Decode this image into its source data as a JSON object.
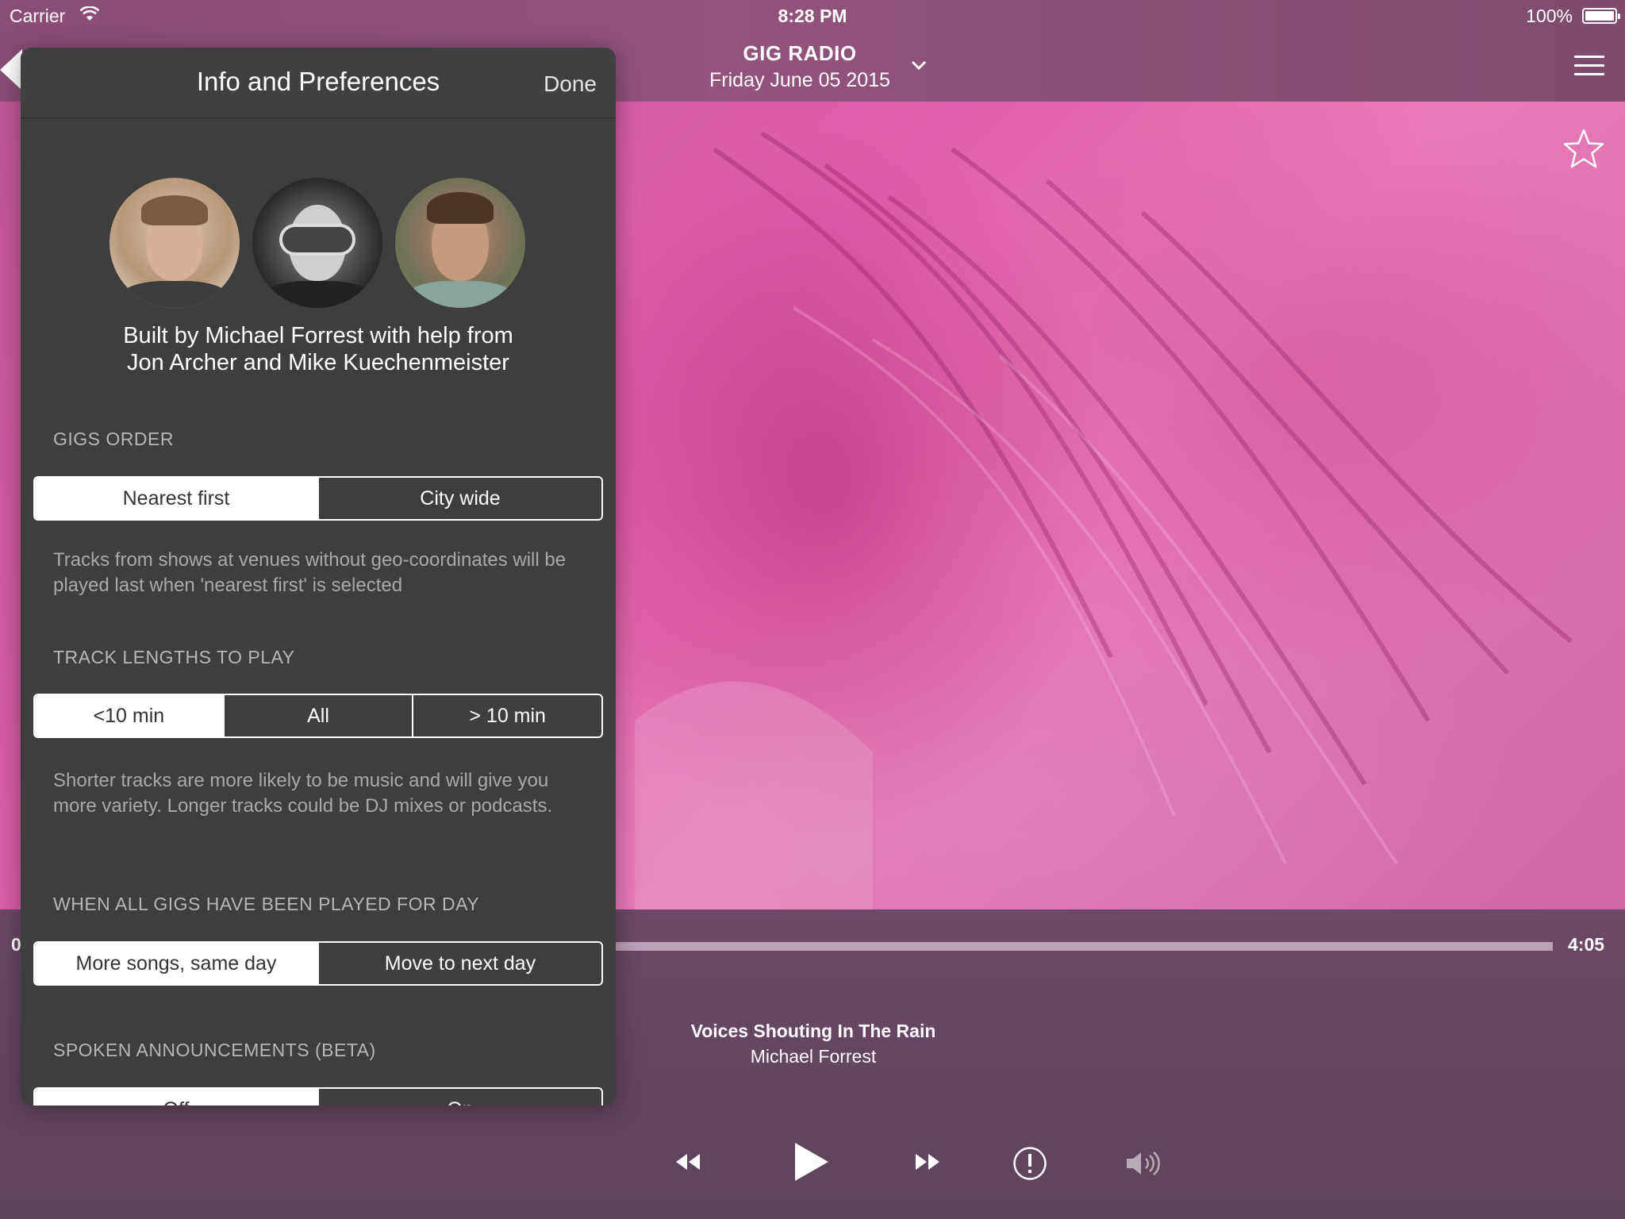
{
  "status_bar": {
    "carrier": "Carrier",
    "time": "8:28 PM",
    "battery": "100%"
  },
  "nav": {
    "station_name": "GIG RADIO",
    "station_date": "Friday June 05 2015",
    "icons": [
      "back-arrow-icon",
      "chevron-down-icon",
      "hamburger-menu-icon",
      "star-icon"
    ]
  },
  "player": {
    "elapsed": "0",
    "duration": "4:05",
    "progress": 0.0,
    "track_title": "Voices Shouting In The Rain",
    "track_artist": "Michael Forrest",
    "controls": [
      "rewind-icon",
      "play-icon",
      "fast-forward-icon",
      "info-icon",
      "volume-icon"
    ]
  },
  "popover": {
    "title": "Info and Preferences",
    "done_label": "Done",
    "credits_line1": "Built by Michael Forrest with help from",
    "credits_line2": "Jon Archer and Mike Kuechenmeister",
    "sections": {
      "gigs_order": {
        "label": "GIGS ORDER",
        "options": [
          "Nearest first",
          "City wide"
        ],
        "selected": 0,
        "help": "Tracks from shows at venues without geo-coordinates will be played last when 'nearest first' is selected"
      },
      "track_lengths": {
        "label": "TRACK LENGTHS TO PLAY",
        "options": [
          "<10 min",
          "All",
          "> 10 min"
        ],
        "selected": 0,
        "help": "Shorter tracks are more likely to be music and will give you more variety. Longer tracks could be DJ mixes or podcasts."
      },
      "when_all_played": {
        "label": "WHEN ALL GIGS HAVE BEEN PLAYED FOR DAY",
        "options": [
          "More songs, same day",
          "Move to next day"
        ],
        "selected": 0
      },
      "spoken": {
        "label": "SPOKEN ANNOUNCEMENTS (BETA)",
        "options": [
          "Off",
          "On"
        ],
        "selected": 0
      }
    }
  },
  "colors": {
    "popover_bg": "#3e3e3e",
    "accent_pink": "#e05fae",
    "section_label": "#b7b7b7"
  }
}
